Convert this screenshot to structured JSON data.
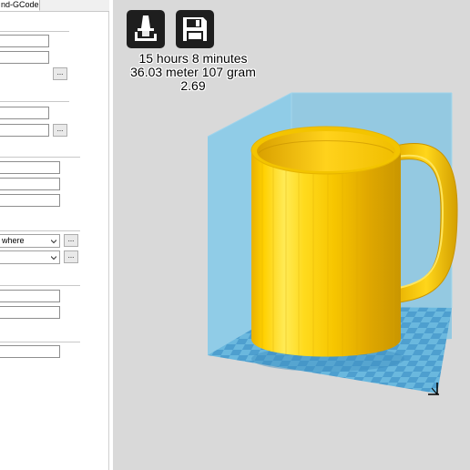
{
  "panel": {
    "tab_label": "nd-GCode",
    "combo_1_value": "where",
    "combo_2_value": "",
    "browse_label": "..."
  },
  "viewport": {
    "print_time": "15 hours 8 minutes",
    "filament": "36.03 meter 107 gram",
    "cost": "2.69",
    "buttons": [
      {
        "name": "load-model",
        "icon": "printer-load-icon"
      },
      {
        "name": "save-gcode",
        "icon": "floppy-disk-icon"
      }
    ],
    "colors": {
      "background": "#d9d9d9",
      "model": "#ffd21c",
      "build_volume": "#7cc3e3",
      "platform_checker": "#5aa9d4"
    }
  }
}
